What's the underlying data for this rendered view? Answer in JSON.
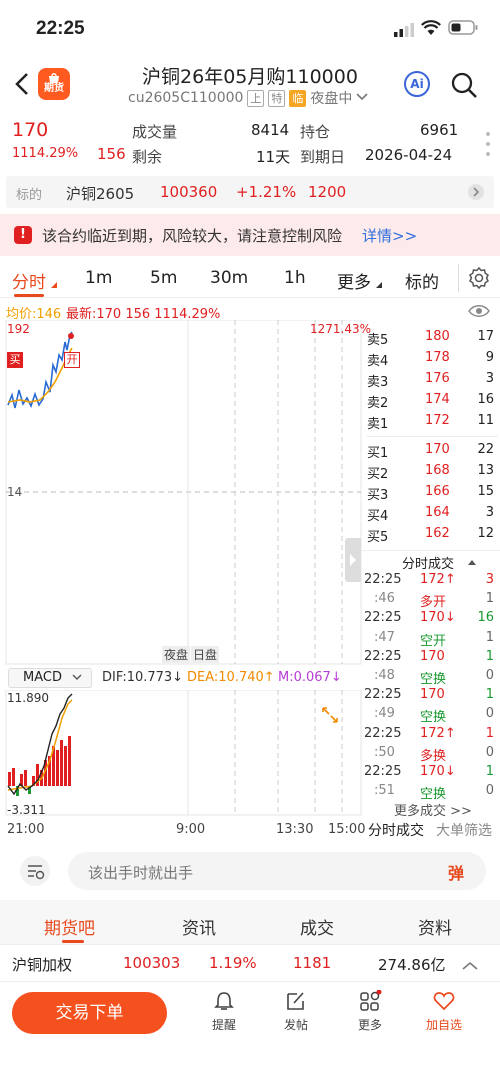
{
  "status": {
    "time": "22:25"
  },
  "header": {
    "logo_text": "期货",
    "title": "沪铜26年05月购110000",
    "code": "cu2605C110000",
    "tag_exchange": "上",
    "tag_special": "特",
    "tag_warn": "临",
    "market_state": "夜盘中",
    "ai_label": "Ai"
  },
  "quote": {
    "price": "170",
    "change_pct": "1114.29%",
    "change_abs": "156",
    "volume_label": "成交量",
    "volume": "8414",
    "oi_label": "持仓",
    "oi": "6961",
    "remain_label": "剩余",
    "remain": "11天",
    "expiry_label": "到期日",
    "expiry": "2026-04-24"
  },
  "underlying": {
    "label": "标的",
    "name": "沪铜2605",
    "price": "100360",
    "pct": "+1.21%",
    "change": "1200"
  },
  "warning": {
    "icon": "!",
    "text": "该合约临近到期，风险较大，请注意控制风险",
    "link": "详情>>"
  },
  "tabs": [
    "分时",
    "1m",
    "5m",
    "30m",
    "1h",
    "更多",
    "标的"
  ],
  "chart": {
    "avg_label": "均价:146",
    "latest_label": "最新:170 156 1114.29%",
    "y_top": "192",
    "y_mid": "14",
    "pct_top": "1271.43%",
    "buy_mark": "买",
    "open_mark": "开",
    "night": "夜盘",
    "day": "日盘",
    "macd_sel": "MACD",
    "dif": "DIF:10.773↓",
    "dea": "DEA:10.740↑",
    "m": "M:0.067↓",
    "macd_top": "11.890",
    "macd_bot": "-3.311",
    "x_labels": [
      "21:00",
      "9:00",
      "13:30",
      "15:00"
    ]
  },
  "orderbook": {
    "asks": [
      {
        "label": "卖5",
        "price": "180",
        "vol": "17"
      },
      {
        "label": "卖4",
        "price": "178",
        "vol": "9"
      },
      {
        "label": "卖3",
        "price": "176",
        "vol": "3"
      },
      {
        "label": "卖2",
        "price": "174",
        "vol": "16"
      },
      {
        "label": "卖1",
        "price": "172",
        "vol": "11"
      }
    ],
    "bids": [
      {
        "label": "买1",
        "price": "170",
        "vol": "22"
      },
      {
        "label": "买2",
        "price": "168",
        "vol": "13"
      },
      {
        "label": "买3",
        "price": "166",
        "vol": "15"
      },
      {
        "label": "买4",
        "price": "164",
        "vol": "3"
      },
      {
        "label": "买5",
        "price": "162",
        "vol": "12"
      }
    ],
    "ticks_title": "分时成交",
    "ticks": [
      {
        "time": "22:25",
        "price": "172↑",
        "vol": "3",
        "pc": "red",
        "vc": "red"
      },
      {
        "time": ":46",
        "price": "多开",
        "vol": "1",
        "pc": "red",
        "vc": "gray"
      },
      {
        "time": "22:25",
        "price": "170↓",
        "vol": "16",
        "pc": "red",
        "vc": "green"
      },
      {
        "time": ":47",
        "price": "空开",
        "vol": "1",
        "pc": "green",
        "vc": "gray"
      },
      {
        "time": "22:25",
        "price": "170",
        "vol": "1",
        "pc": "red",
        "vc": "green"
      },
      {
        "time": ":48",
        "price": "空换",
        "vol": "0",
        "pc": "green",
        "vc": "gray"
      },
      {
        "time": "22:25",
        "price": "170",
        "vol": "1",
        "pc": "red",
        "vc": "green"
      },
      {
        "time": ":49",
        "price": "空换",
        "vol": "0",
        "pc": "green",
        "vc": "gray"
      },
      {
        "time": "22:25",
        "price": "172↑",
        "vol": "1",
        "pc": "red",
        "vc": "red"
      },
      {
        "time": ":50",
        "price": "多换",
        "vol": "0",
        "pc": "red",
        "vc": "gray"
      },
      {
        "time": "22:25",
        "price": "170↓",
        "vol": "1",
        "pc": "red",
        "vc": "green"
      },
      {
        "time": ":51",
        "price": "空换",
        "vol": "0",
        "pc": "green",
        "vc": "gray"
      }
    ],
    "more_ticks": "更多成交 >>",
    "tab_ticks": "分时成交",
    "tab_big": "大单筛选"
  },
  "comment": {
    "placeholder": "该出手时就出手",
    "danmu": "弹"
  },
  "bottom_tabs": [
    "期货吧",
    "资讯",
    "成交",
    "资料"
  ],
  "ticker": {
    "name": "沪铜加权",
    "price": "100303",
    "pct": "1.19%",
    "change": "1181",
    "amount": "274.86亿"
  },
  "bottom_nav": {
    "trade": "交易下单",
    "remind": "提醒",
    "post": "发帖",
    "more": "更多",
    "fav": "加自选"
  }
}
